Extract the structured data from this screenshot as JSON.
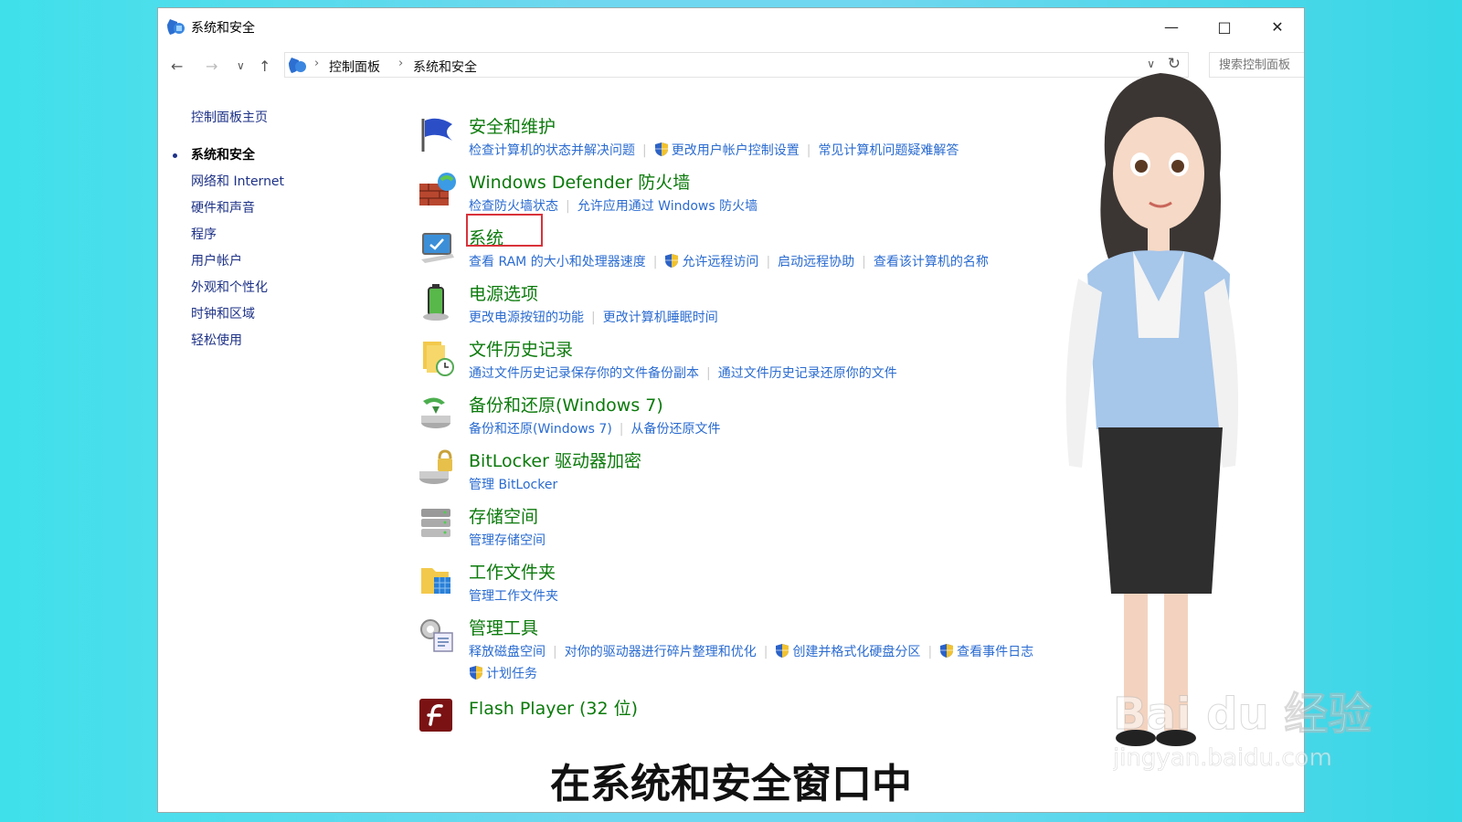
{
  "window": {
    "title": "系统和安全"
  },
  "address": {
    "crumbs": [
      "控制面板",
      "系统和安全"
    ],
    "search_placeholder": "搜索控制面板"
  },
  "sidebar": {
    "home": "控制面板主页",
    "items": [
      "系统和安全",
      "网络和 Internet",
      "硬件和声音",
      "程序",
      "用户帐户",
      "外观和个性化",
      "时钟和区域",
      "轻松使用"
    ]
  },
  "categories": [
    {
      "title": "安全和维护",
      "icon": "flag-icon",
      "links": [
        {
          "t": "检查计算机的状态并解决问题"
        },
        {
          "t": "更改用户帐户控制设置",
          "shield": true
        },
        {
          "t": "常见计算机问题疑难解答"
        }
      ]
    },
    {
      "title": "Windows Defender 防火墙",
      "icon": "firewall-icon",
      "links": [
        {
          "t": "检查防火墙状态"
        },
        {
          "t": "允许应用通过 Windows 防火墙"
        }
      ]
    },
    {
      "title": "系统",
      "icon": "monitor-icon",
      "links": [
        {
          "t": "查看 RAM 的大小和处理器速度"
        },
        {
          "t": "允许远程访问",
          "shield": true
        },
        {
          "t": "启动远程协助"
        },
        {
          "t": "查看该计算机的名称"
        }
      ]
    },
    {
      "title": "电源选项",
      "icon": "battery-icon",
      "links": [
        {
          "t": "更改电源按钮的功能"
        },
        {
          "t": "更改计算机睡眠时间"
        }
      ]
    },
    {
      "title": "文件历史记录",
      "icon": "file-history-icon",
      "links": [
        {
          "t": "通过文件历史记录保存你的文件备份副本"
        },
        {
          "t": "通过文件历史记录还原你的文件"
        }
      ]
    },
    {
      "title": "备份和还原(Windows 7)",
      "icon": "backup-icon",
      "links": [
        {
          "t": "备份和还原(Windows 7)"
        },
        {
          "t": "从备份还原文件"
        }
      ]
    },
    {
      "title": "BitLocker 驱动器加密",
      "icon": "bitlocker-icon",
      "links": [
        {
          "t": "管理 BitLocker"
        }
      ]
    },
    {
      "title": "存储空间",
      "icon": "storage-icon",
      "links": [
        {
          "t": "管理存储空间"
        }
      ]
    },
    {
      "title": "工作文件夹",
      "icon": "work-folder-icon",
      "links": [
        {
          "t": "管理工作文件夹"
        }
      ]
    },
    {
      "title": "管理工具",
      "icon": "admin-tools-icon",
      "links": [
        {
          "t": "释放磁盘空间"
        },
        {
          "t": "对你的驱动器进行碎片整理和优化"
        },
        {
          "t": "创建并格式化硬盘分区",
          "shield": true
        },
        {
          "t": "查看事件日志",
          "shield": true
        }
      ],
      "links2": [
        {
          "t": "计划任务",
          "shield": true
        }
      ]
    },
    {
      "title": "Flash Player (32 位)",
      "icon": "flash-icon",
      "links": []
    }
  ],
  "caption": "在系统和安全窗口中",
  "watermark": {
    "brand": "Bai du 经验",
    "url": "jingyan.baidu.com"
  }
}
